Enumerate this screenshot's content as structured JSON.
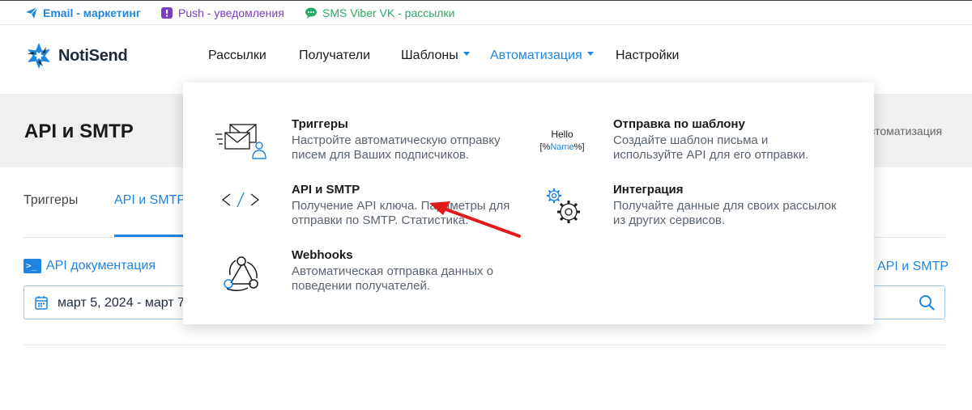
{
  "topbar": {
    "email_label": "Email - маркетинг",
    "push_label": "Push - уведомления",
    "sms_label": "SMS Viber VK - рассылки",
    "email_color": "#1e86e0",
    "push_color": "#7a3fc0",
    "sms_color": "#2aa86a"
  },
  "header": {
    "logo_text": "NotiSend",
    "nav": [
      {
        "label": "Рассылки"
      },
      {
        "label": "Получатели"
      },
      {
        "label": "Шаблоны"
      },
      {
        "label": "Автоматизация"
      },
      {
        "label": "Настройки"
      }
    ]
  },
  "banner": {
    "page_title": "API и SMTP",
    "breadcrumb_tail": "втоматизация"
  },
  "tabs": [
    {
      "label": "Триггеры"
    },
    {
      "label": "API и SMTP"
    }
  ],
  "api_doc_label": "API документация",
  "api_right_label": "API и SMTP",
  "date_range": "март 5, 2024 - март 7,",
  "dropdown": {
    "items": [
      {
        "title": "Триггеры",
        "desc1": "Настройте автоматическую отправку",
        "desc2": "писем для Ваших подписчиков.",
        "icon": "mail-user-icon"
      },
      {
        "title": "API и SMTP",
        "desc1": "Получение API ключа. Параметры для",
        "desc2": "отправки по SMTP. Статистика.",
        "icon": "code-icon"
      },
      {
        "title": "Webhooks",
        "desc1": "Автоматическая отправка данных о",
        "desc2": "поведении получателей.",
        "icon": "webhook-icon"
      },
      {
        "title": "Отправка по шаблону",
        "desc1": "Создайте шаблон письма и",
        "desc2": "используйте API для его отправки.",
        "icon": "template-icon"
      },
      {
        "title": "Интеграция",
        "desc1": "Получайте данные для своих рассылок",
        "desc2": "из других сервисов.",
        "icon": "gears-icon"
      }
    ],
    "hello_line1": "Hello",
    "hello_prefix": "[%",
    "hello_name": "Name",
    "hello_suffix": "%]"
  },
  "colors": {
    "accent": "#1e86e0",
    "annotation_arrow": "#e0191b"
  }
}
